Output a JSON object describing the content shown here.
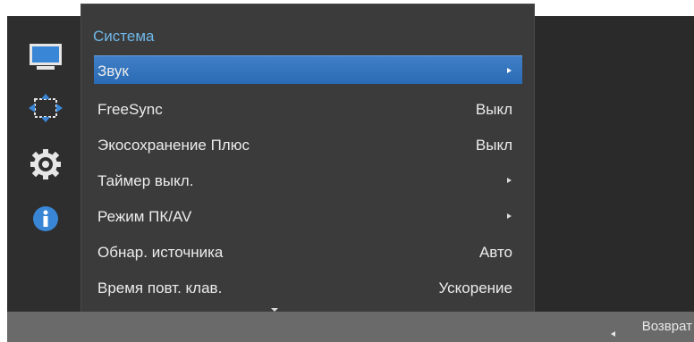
{
  "menu": {
    "title": "Система",
    "items": [
      {
        "label": "Звук",
        "value": "",
        "has_submenu": true,
        "selected": true
      },
      {
        "label": "FreeSync",
        "value": "Выкл",
        "has_submenu": false,
        "selected": false
      },
      {
        "label": "Экосохранение Плюс",
        "value": "Выкл",
        "has_submenu": false,
        "selected": false
      },
      {
        "label": "Таймер выкл.",
        "value": "",
        "has_submenu": true,
        "selected": false
      },
      {
        "label": "Режим ПК/AV",
        "value": "",
        "has_submenu": true,
        "selected": false
      },
      {
        "label": "Обнар. источника",
        "value": "Авто",
        "has_submenu": false,
        "selected": false
      },
      {
        "label": "Время повт. клав.",
        "value": "Ускорение",
        "has_submenu": false,
        "selected": false
      }
    ]
  },
  "sidebar": {
    "icons": [
      "monitor-icon",
      "move-icon",
      "gear-icon",
      "info-icon"
    ]
  },
  "footer": {
    "return_label": "Возврат"
  },
  "colors": {
    "accent_title": "#6fb8ea",
    "selected_bg": "#2f71bb",
    "menu_bg": "#3b3b3b",
    "bottom_bar": "#6a6a6a"
  }
}
